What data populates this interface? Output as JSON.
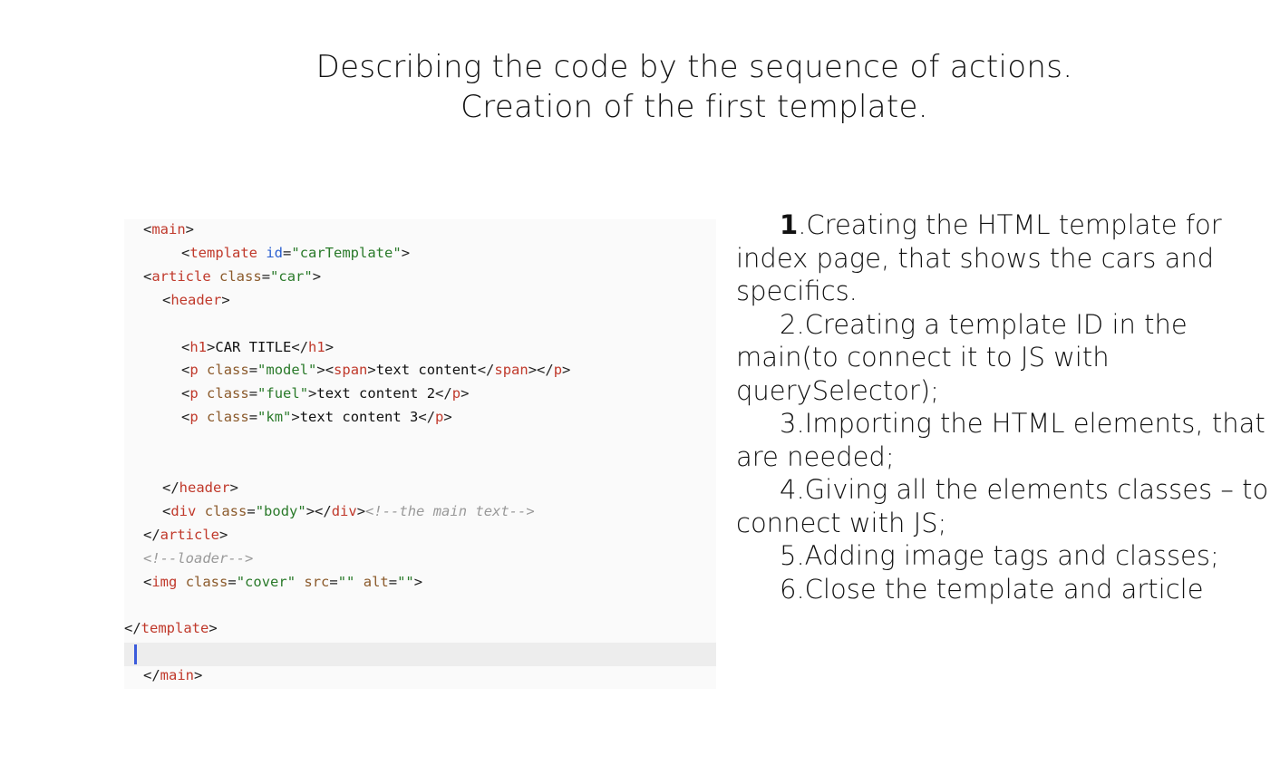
{
  "title": {
    "line1": "Describing the code by the sequence of actions.",
    "line2": "Creation of the first template."
  },
  "code": {
    "lines": [
      [
        {
          "t": "br",
          "v": "<"
        },
        {
          "t": "tag",
          "v": "main"
        },
        {
          "t": "br",
          "v": ">"
        }
      ],
      [
        {
          "t": "br",
          "v": "<"
        },
        {
          "t": "tag",
          "v": "template"
        },
        {
          "t": "txt",
          "v": " "
        },
        {
          "t": "id",
          "v": "id"
        },
        {
          "t": "br",
          "v": "="
        },
        {
          "t": "str",
          "v": "\"carTemplate\""
        },
        {
          "t": "br",
          "v": ">"
        }
      ],
      [
        {
          "t": "br",
          "v": "<"
        },
        {
          "t": "tag",
          "v": "article"
        },
        {
          "t": "txt",
          "v": " "
        },
        {
          "t": "attr",
          "v": "class"
        },
        {
          "t": "br",
          "v": "="
        },
        {
          "t": "str",
          "v": "\"car\""
        },
        {
          "t": "br",
          "v": ">"
        }
      ],
      [
        {
          "t": "br",
          "v": "<"
        },
        {
          "t": "tag",
          "v": "header"
        },
        {
          "t": "br",
          "v": ">"
        }
      ],
      [],
      [
        {
          "t": "br",
          "v": "<"
        },
        {
          "t": "tag",
          "v": "h1"
        },
        {
          "t": "br",
          "v": ">"
        },
        {
          "t": "txt",
          "v": "CAR TITLE"
        },
        {
          "t": "br",
          "v": "</"
        },
        {
          "t": "tag",
          "v": "h1"
        },
        {
          "t": "br",
          "v": ">"
        }
      ],
      [
        {
          "t": "br",
          "v": "<"
        },
        {
          "t": "tag",
          "v": "p"
        },
        {
          "t": "txt",
          "v": " "
        },
        {
          "t": "attr",
          "v": "class"
        },
        {
          "t": "br",
          "v": "="
        },
        {
          "t": "str",
          "v": "\"model\""
        },
        {
          "t": "br",
          "v": "><"
        },
        {
          "t": "tag",
          "v": "span"
        },
        {
          "t": "br",
          "v": ">"
        },
        {
          "t": "txt",
          "v": "text content"
        },
        {
          "t": "br",
          "v": "</"
        },
        {
          "t": "tag",
          "v": "span"
        },
        {
          "t": "br",
          "v": "></"
        },
        {
          "t": "tag",
          "v": "p"
        },
        {
          "t": "br",
          "v": ">"
        }
      ],
      [
        {
          "t": "br",
          "v": "<"
        },
        {
          "t": "tag",
          "v": "p"
        },
        {
          "t": "txt",
          "v": " "
        },
        {
          "t": "attr",
          "v": "class"
        },
        {
          "t": "br",
          "v": "="
        },
        {
          "t": "str",
          "v": "\"fuel\""
        },
        {
          "t": "br",
          "v": ">"
        },
        {
          "t": "txt",
          "v": "text content 2"
        },
        {
          "t": "br",
          "v": "</"
        },
        {
          "t": "tag",
          "v": "p"
        },
        {
          "t": "br",
          "v": ">"
        }
      ],
      [
        {
          "t": "br",
          "v": "<"
        },
        {
          "t": "tag",
          "v": "p"
        },
        {
          "t": "txt",
          "v": " "
        },
        {
          "t": "attr",
          "v": "class"
        },
        {
          "t": "br",
          "v": "="
        },
        {
          "t": "str",
          "v": "\"km\""
        },
        {
          "t": "br",
          "v": ">"
        },
        {
          "t": "txt",
          "v": "text content 3"
        },
        {
          "t": "br",
          "v": "</"
        },
        {
          "t": "tag",
          "v": "p"
        },
        {
          "t": "br",
          "v": ">"
        }
      ],
      [],
      [],
      [
        {
          "t": "br",
          "v": "</"
        },
        {
          "t": "tag",
          "v": "header"
        },
        {
          "t": "br",
          "v": ">"
        }
      ],
      [
        {
          "t": "br",
          "v": "<"
        },
        {
          "t": "tag",
          "v": "div"
        },
        {
          "t": "txt",
          "v": " "
        },
        {
          "t": "attr",
          "v": "class"
        },
        {
          "t": "br",
          "v": "="
        },
        {
          "t": "str",
          "v": "\"body\""
        },
        {
          "t": "br",
          "v": "></"
        },
        {
          "t": "tag",
          "v": "div"
        },
        {
          "t": "br",
          "v": ">"
        },
        {
          "t": "cmt",
          "v": "<!--the main text-->"
        }
      ],
      [
        {
          "t": "br",
          "v": "</"
        },
        {
          "t": "tag",
          "v": "article"
        },
        {
          "t": "br",
          "v": ">"
        }
      ],
      [
        {
          "t": "cmt",
          "v": "<!--loader-->"
        }
      ],
      [
        {
          "t": "br",
          "v": "<"
        },
        {
          "t": "tag",
          "v": "img"
        },
        {
          "t": "txt",
          "v": " "
        },
        {
          "t": "attr",
          "v": "class"
        },
        {
          "t": "br",
          "v": "="
        },
        {
          "t": "str",
          "v": "\"cover\""
        },
        {
          "t": "txt",
          "v": " "
        },
        {
          "t": "attr",
          "v": "src"
        },
        {
          "t": "br",
          "v": "="
        },
        {
          "t": "str",
          "v": "\"\""
        },
        {
          "t": "txt",
          "v": " "
        },
        {
          "t": "attr",
          "v": "alt"
        },
        {
          "t": "br",
          "v": "="
        },
        {
          "t": "str",
          "v": "\"\""
        },
        {
          "t": "br",
          "v": ">"
        }
      ],
      [],
      [
        {
          "t": "br",
          "v": "</"
        },
        {
          "t": "tag",
          "v": "template"
        },
        {
          "t": "br",
          "v": ">"
        }
      ],
      [],
      [
        {
          "t": "br",
          "v": "</"
        },
        {
          "t": "tag",
          "v": "main"
        },
        {
          "t": "br",
          "v": ">"
        }
      ]
    ]
  },
  "steps": [
    {
      "num": "1",
      "text": ".Creating the HTML template for index page, that shows the cars and specifics."
    },
    {
      "num": "2",
      "text": ".Creating a template ID in the main(to connect it to JS with querySelector);"
    },
    {
      "num": "3",
      "text": ".Importing the HTML elements, that are needed;"
    },
    {
      "num": "4",
      "text": ".Giving all the elements classes – to connect with JS;"
    },
    {
      "num": "5",
      "text": ".Adding image tags and classes;"
    },
    {
      "num": "6",
      "text": ".Close the template and article"
    }
  ]
}
